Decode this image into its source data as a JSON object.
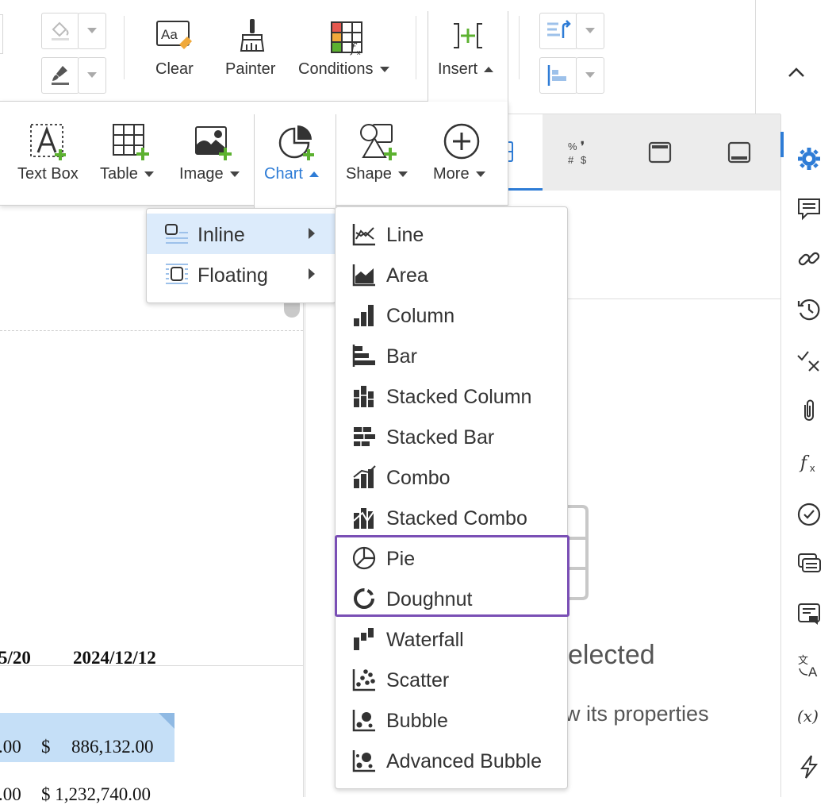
{
  "toolbar_top": {
    "clear_label": "Clear",
    "painter_label": "Painter",
    "conditions_label": "Conditions",
    "insert_label": "Insert"
  },
  "insert_panel": {
    "text_box_label": "Text Box",
    "table_label": "Table",
    "image_label": "Image",
    "chart_label": "Chart",
    "shape_label": "Shape",
    "more_label": "More"
  },
  "chart_placement_menu": {
    "items": [
      {
        "label": "Inline",
        "highlighted": true
      },
      {
        "label": "Floating",
        "highlighted": false
      }
    ]
  },
  "chart_type_menu": {
    "items": [
      {
        "label": "Line",
        "icon": "line-chart-icon"
      },
      {
        "label": "Area",
        "icon": "area-chart-icon"
      },
      {
        "label": "Column",
        "icon": "column-chart-icon"
      },
      {
        "label": "Bar",
        "icon": "bar-chart-icon"
      },
      {
        "label": "Stacked Column",
        "icon": "stacked-column-icon"
      },
      {
        "label": "Stacked Bar",
        "icon": "stacked-bar-icon"
      },
      {
        "label": "Combo",
        "icon": "combo-chart-icon"
      },
      {
        "label": "Stacked Combo",
        "icon": "stacked-combo-icon"
      },
      {
        "label": "Pie",
        "icon": "pie-chart-icon"
      },
      {
        "label": "Doughnut",
        "icon": "doughnut-chart-icon"
      },
      {
        "label": "Waterfall",
        "icon": "waterfall-chart-icon"
      },
      {
        "label": "Scatter",
        "icon": "scatter-chart-icon"
      },
      {
        "label": "Bubble",
        "icon": "bubble-chart-icon"
      },
      {
        "label": "Advanced Bubble",
        "icon": "advanced-bubble-icon"
      }
    ],
    "highlight_color": "#7a4fb5"
  },
  "properties_panel": {
    "tab_format_label": "% ❘ # $",
    "empty_text_partial": "elected",
    "hint_text_partial": "w its properties"
  },
  "document": {
    "header_col1": "5/20",
    "header_col2": "2024/12/12",
    "row1_col1": ".00",
    "row1_currency": "$",
    "row1_col2": "886,132.00",
    "row2_col1": ".00",
    "row2_col2": "$ 1,232,740.00"
  },
  "colors": {
    "accent_blue": "#2e7cd6",
    "add_green": "#5cb130",
    "menu_highlight": "#dcebfb"
  }
}
